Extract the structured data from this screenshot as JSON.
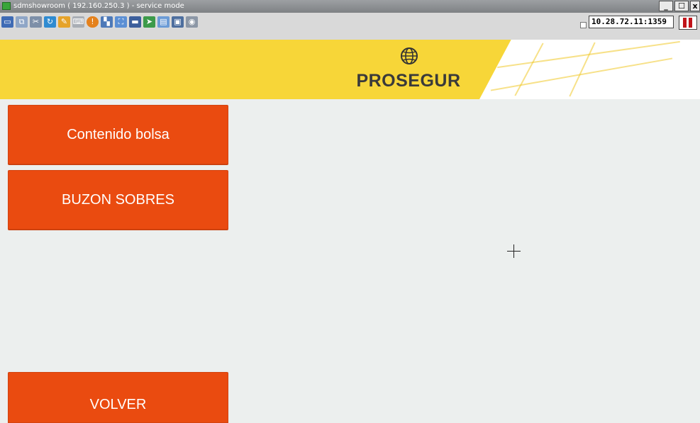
{
  "window": {
    "title": "sdmshowroom ( 192.160.250.3 ) - service mode",
    "controls": {
      "minimize": "_",
      "maximize": "☐",
      "close": "x"
    }
  },
  "toolbar": {
    "icons": [
      "display-icon",
      "copy-icon",
      "scissors-icon",
      "refresh-icon",
      "paint-icon",
      "keyboard-icon",
      "alert-icon",
      "network-icon",
      "fullscreen-icon",
      "monitor-icon",
      "arrow-icon",
      "file-icon",
      "window-icon",
      "camera-icon"
    ],
    "host_address": "10.28.72.11:1359"
  },
  "header": {
    "brand": "PROSEGUR",
    "colors": {
      "banner": "#f7d638",
      "accent": "#ea4b10"
    }
  },
  "menu": {
    "contenido_bolsa": "Contenido bolsa",
    "buzon_sobres": "BUZON SOBRES",
    "volver": "VOLVER"
  }
}
